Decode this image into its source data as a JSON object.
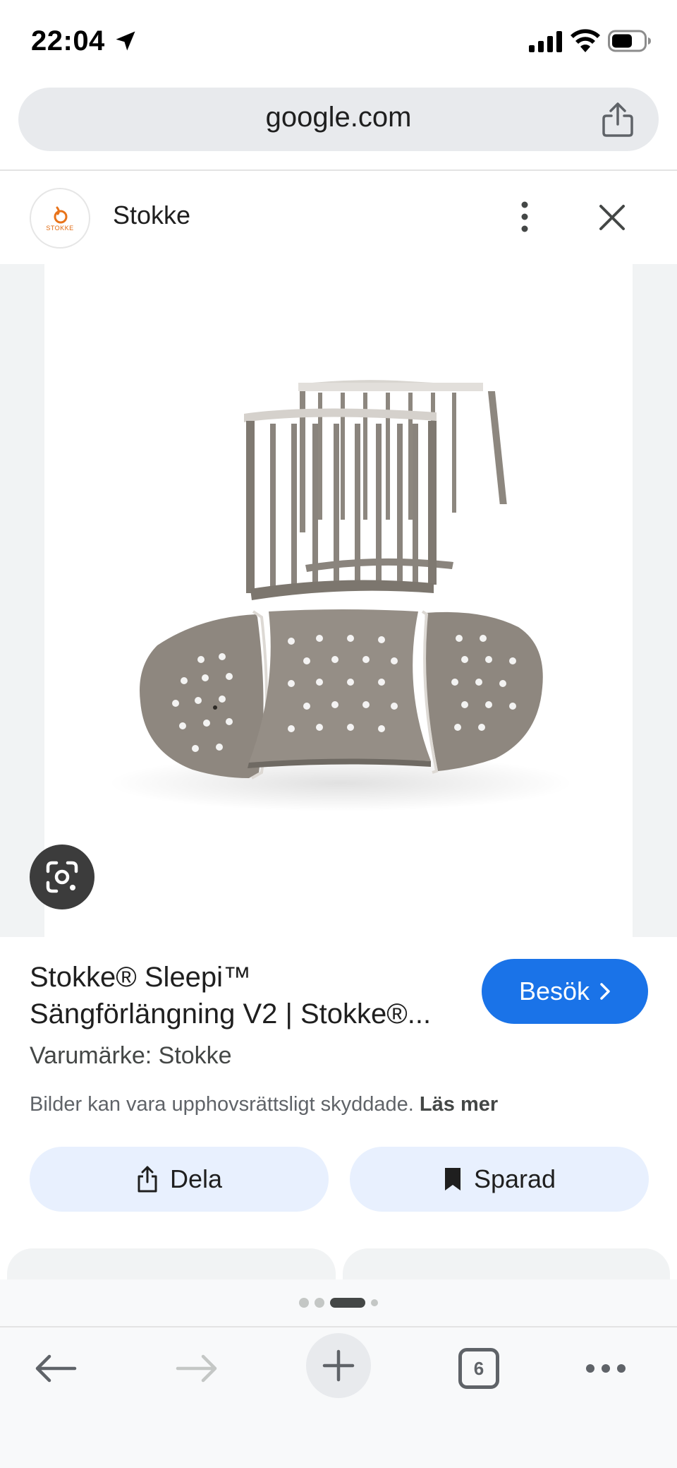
{
  "status_bar": {
    "time": "22:04",
    "icons": [
      "location-arrow-icon",
      "cellular-signal-icon",
      "wifi-icon",
      "battery-icon"
    ]
  },
  "browser": {
    "url": "google.com",
    "share_icon": "share-icon"
  },
  "image_source": {
    "logo_text": "STOKKE",
    "name": "Stokke",
    "more_icon": "more-vertical-icon",
    "close_icon": "close-icon"
  },
  "viewer": {
    "lens_icon": "google-lens-icon",
    "image_subject": "Stokke Sleepi bed extension parts"
  },
  "product": {
    "title_line1": "Stokke® Sleepi™",
    "title_line2": "Sängförlängning V2 | Stokke®...",
    "visit_label": "Besök",
    "brand": "Varumärke: Stokke",
    "copyright_text": "Bilder kan vara upphovsrättsligt skyddade.",
    "learn_more": "Läs mer"
  },
  "actions": {
    "share_label": "Dela",
    "saved_label": "Sparad"
  },
  "pagination": {
    "current_index": 2,
    "total_dots": 4
  },
  "toolbar": {
    "tabs_count": "6",
    "icons": [
      "back-arrow-icon",
      "forward-arrow-icon",
      "plus-icon",
      "tabs-icon",
      "more-horizontal-icon"
    ]
  },
  "colors": {
    "accent": "#1a73e8",
    "chip_bg": "#e8f0fe",
    "surface": "#e8eaed",
    "wood": "#8a847d"
  }
}
